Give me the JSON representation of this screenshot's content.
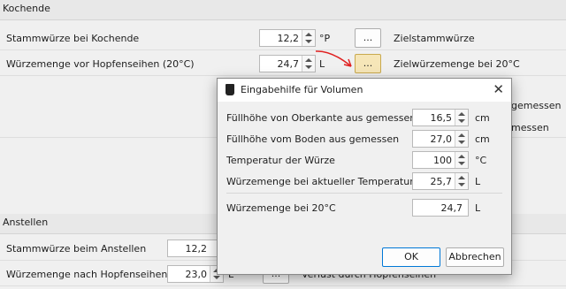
{
  "kochende": {
    "header": "Kochende",
    "rows": [
      {
        "label": "Stammwürze bei Kochende",
        "value": "12,2",
        "unit": "°P",
        "button": "...",
        "right": "Zielstammwürze"
      },
      {
        "label": "Würzemenge vor Hopfenseihen (20°C)",
        "value": "24,7",
        "unit": "L",
        "button": "...",
        "right": "Zielwürzemenge bei 20°C"
      }
    ],
    "partial_right": [
      "gemessen",
      "messen"
    ]
  },
  "anstellen": {
    "header": "Anstellen",
    "rows": [
      {
        "label": "Stammwürze beim Anstellen",
        "value": "12,2"
      },
      {
        "label": "Würzemenge nach Hopfenseihen",
        "value": "23,0",
        "unit": "L",
        "button": "...",
        "right": "Verlust durch Hopfenseihen"
      }
    ]
  },
  "dialog": {
    "title": "Eingabehilfe für Volumen",
    "close": "✕",
    "fields": [
      {
        "label": "Füllhöhe von Oberkante aus gemessen",
        "value": "16,5",
        "unit": "cm"
      },
      {
        "label": "Füllhöhe vom Boden aus gemessen",
        "value": "27,0",
        "unit": "cm"
      },
      {
        "label": "Temperatur der Würze",
        "value": "100",
        "unit": "°C"
      },
      {
        "label": "Würzemenge bei aktueller Temperatur",
        "value": "25,7",
        "unit": "L"
      }
    ],
    "result": {
      "label": "Würzemenge bei 20°C",
      "value": "24,7",
      "unit": "L"
    },
    "ok": "OK",
    "cancel": "Abbrechen"
  },
  "colors": {
    "arrow": "#e02020",
    "highlight_button": "#f6e6b8"
  }
}
